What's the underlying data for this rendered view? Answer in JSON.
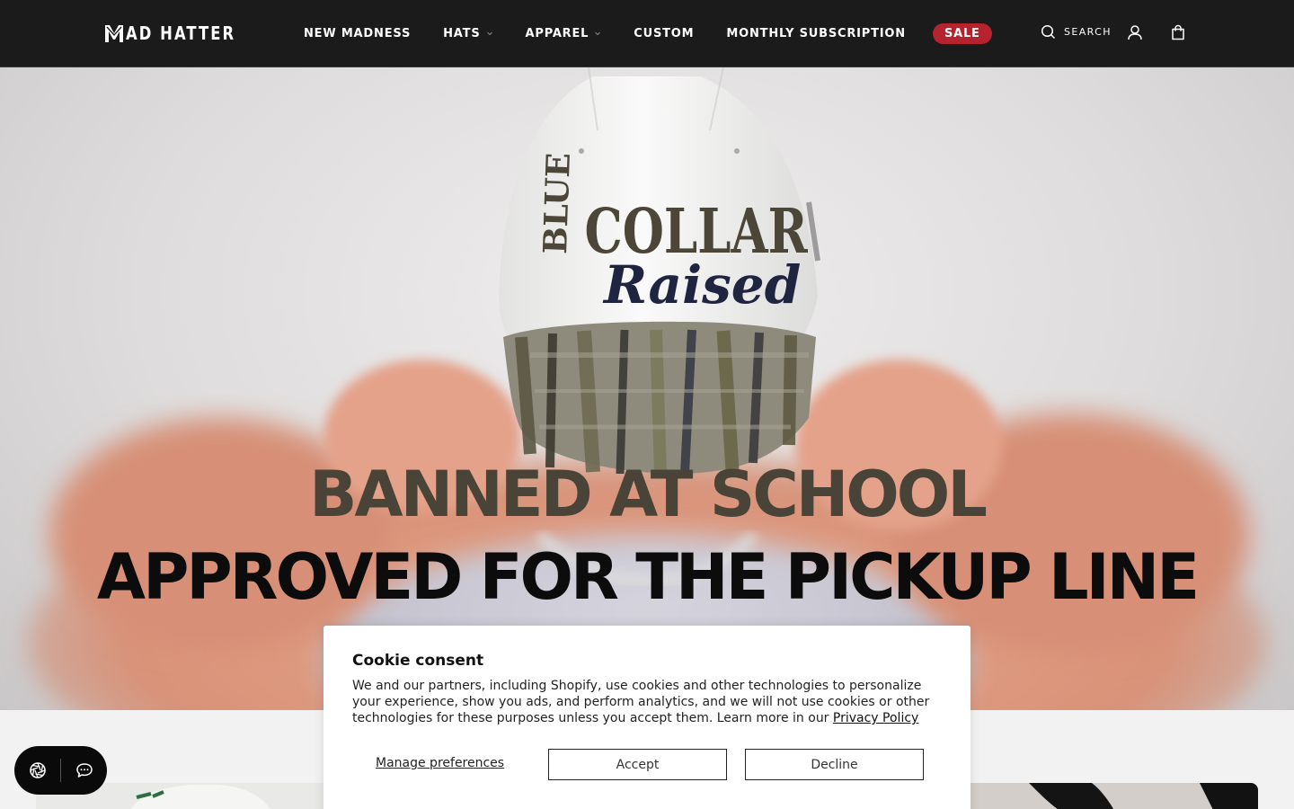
{
  "header": {
    "logo_text": "AD HATTER",
    "nav": [
      {
        "label": "NEW MADNESS",
        "has_dropdown": false
      },
      {
        "label": "HATS",
        "has_dropdown": true
      },
      {
        "label": "APPAREL",
        "has_dropdown": true
      },
      {
        "label": "CUSTOM",
        "has_dropdown": false
      },
      {
        "label": "MONTHLY SUBSCRIPTION",
        "has_dropdown": false
      }
    ],
    "sale_label": "SALE",
    "search_label": "SEARCH",
    "icons": {
      "search": "search-icon",
      "account": "user-icon",
      "cart": "shopping-bag-icon",
      "dropdown": "chevron-down-icon"
    }
  },
  "hero": {
    "headline_line1": "BANNED AT SCHOOL",
    "headline_line2": "APPROVED FOR THE PICKUP LINE",
    "hat_text_top_left": "BLUE",
    "hat_text_top_right": "COLLAR",
    "hat_text_script": "Raised"
  },
  "cookie": {
    "title": "Cookie consent",
    "body": "We and our partners, including Shopify, use cookies and other technologies to personalize your experience, show you ads, and perform analytics, and we will not use cookies or other technologies for these purposes unless you accept them. Learn more in our ",
    "link_text": "Privacy Policy",
    "manage_label": "Manage preferences",
    "accept_label": "Accept",
    "decline_label": "Decline"
  },
  "widget": {
    "icons": [
      "aperture-icon",
      "chat-bubble-icon"
    ]
  },
  "colors": {
    "header_bg": "#1b1b1b",
    "sale_badge": "#b5232e",
    "headline_top": "#4a4438",
    "headline_bottom": "#0c0c0c"
  }
}
